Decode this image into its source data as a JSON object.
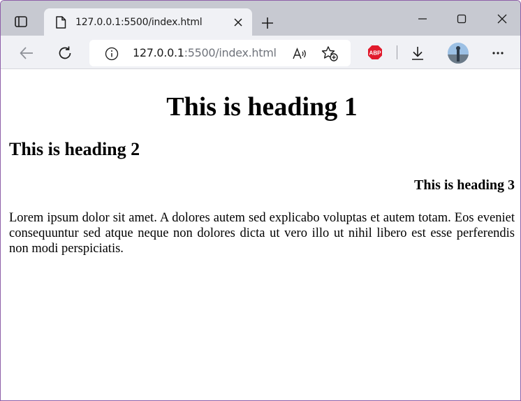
{
  "browser": {
    "tab": {
      "title": "127.0.0.1:5500/index.html"
    },
    "address_bar": {
      "host": "127.0.0.1",
      "path": ":5500/index.html"
    },
    "extensions": {
      "abp_label": "ABP"
    }
  },
  "icons": [
    "tab-actions-icon",
    "page-icon",
    "close-icon",
    "plus-icon",
    "minimize-icon",
    "maximize-icon",
    "back-icon",
    "refresh-icon",
    "info-icon",
    "read-aloud-icon",
    "favorites-add-icon",
    "download-icon",
    "more-icon"
  ],
  "colors": {
    "titlebar": "#c7c9d1",
    "toolbar": "#f0f1f5",
    "abp": "#e11a2c",
    "window_border": "#8e5fa8"
  },
  "content": {
    "h1": "This is heading 1",
    "h2": "This is heading 2",
    "h3": "This is heading 3",
    "paragraph": "Lorem ipsum dolor sit amet. A dolores autem sed explicabo voluptas et autem totam. Eos eveniet consequuntur sed atque neque non dolores dicta ut vero illo ut nihil libero est esse perferendis non modi perspiciatis."
  }
}
